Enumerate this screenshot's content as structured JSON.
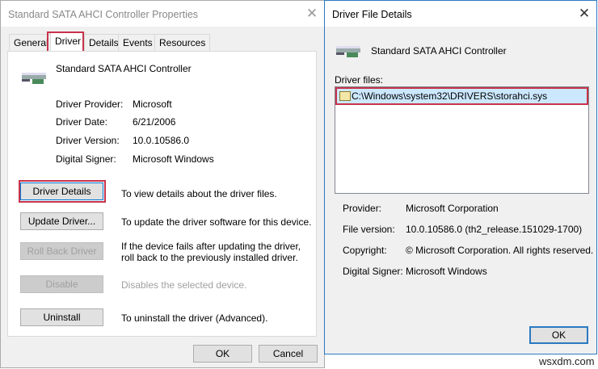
{
  "properties_window": {
    "title": "Standard SATA AHCI Controller Properties",
    "tabs": [
      {
        "label": "General"
      },
      {
        "label": "Driver"
      },
      {
        "label": "Details"
      },
      {
        "label": "Events"
      },
      {
        "label": "Resources"
      }
    ],
    "active_tab": "Driver",
    "device_name": "Standard SATA AHCI Controller",
    "info": [
      {
        "label": "Driver Provider:",
        "value": "Microsoft"
      },
      {
        "label": "Driver Date:",
        "value": "6/21/2006"
      },
      {
        "label": "Driver Version:",
        "value": "10.0.10586.0"
      },
      {
        "label": "Digital Signer:",
        "value": "Microsoft Windows"
      }
    ],
    "actions": [
      {
        "button": "Driver Details",
        "description": "To view details about the driver files."
      },
      {
        "button": "Update Driver...",
        "description": "To update the driver software for this device."
      },
      {
        "button": "Roll Back Driver",
        "description": "If the device fails after updating the driver, roll back to the previously installed driver."
      },
      {
        "button": "Disable",
        "description": "Disables the selected device."
      },
      {
        "button": "Uninstall",
        "description": "To uninstall the driver (Advanced)."
      }
    ],
    "ok_label": "OK",
    "cancel_label": "Cancel"
  },
  "file_details_window": {
    "title": "Driver File Details",
    "device_name": "Standard SATA AHCI Controller",
    "files_label": "Driver files:",
    "files": [
      "C:\\Windows\\system32\\DRIVERS\\storahci.sys"
    ],
    "info": [
      {
        "label": "Provider:",
        "value": "Microsoft Corporation"
      },
      {
        "label": "File version:",
        "value": "10.0.10586.0 (th2_release.151029-1700)"
      },
      {
        "label": "Copyright:",
        "value": "© Microsoft Corporation. All rights reserved."
      },
      {
        "label": "Digital Signer:",
        "value": "Microsoft Windows"
      }
    ],
    "ok_label": "OK"
  },
  "watermark": "wsxdm.com",
  "colors": {
    "highlight": "#c8334a",
    "selection": "#cce8ff",
    "window_border": "#2b79c2"
  }
}
